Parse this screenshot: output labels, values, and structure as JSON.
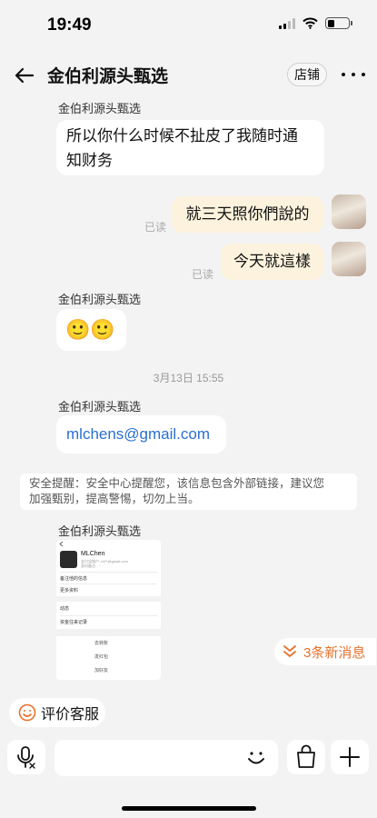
{
  "status_bar": {
    "time": "19:49",
    "battery_level": 0.35
  },
  "header": {
    "title": "金伯利源头甄选",
    "shop_label": "店铺"
  },
  "messages": {
    "m1": {
      "sender": "金伯利源头甄选",
      "line1": "所以你什么时候不扯皮了我随时通",
      "line2": "知财务"
    },
    "m2": {
      "text": "就三天照你們說的",
      "status": "已读"
    },
    "m3": {
      "text": "今天就這樣",
      "status": "已读"
    },
    "m4": {
      "sender": "金伯利源头甄选",
      "text": "🙂🙂"
    },
    "timestamp": "3月13日 15:55",
    "m5": {
      "sender": "金伯利源头甄选",
      "text": "mlchens@gmail.com"
    },
    "notice": {
      "line1": "安全提醒：安全中心提醒您，该信息包含外部链接，建议您",
      "line2": "加强甄别，提高警惕，切勿上当。"
    },
    "m6": {
      "sender": "金伯利源头甄选",
      "screenshot": {
        "name": "MLChen",
        "sub1": "支付宝账户: ml**@gmail.com",
        "sub2": "身份备注: ···",
        "row1": "备注他的信息",
        "row2": "更多资料",
        "row3": "动态",
        "row4": "资金往来记录",
        "btn1": "去转账",
        "btn2": "发红包",
        "btn3": "加好友"
      }
    }
  },
  "new_messages_label": "3条新消息",
  "rate_label": "评价客服",
  "input": {
    "placeholder": ""
  },
  "colors": {
    "accent": "#e8712c",
    "link": "#2a6fd0",
    "own_bubble": "#fcf2dd"
  },
  "icons": [
    "back-arrow-icon",
    "more-icon",
    "chevron-double-down-icon",
    "smile-icon",
    "voice-icon",
    "emoji-icon",
    "bag-icon",
    "plus-icon"
  ]
}
